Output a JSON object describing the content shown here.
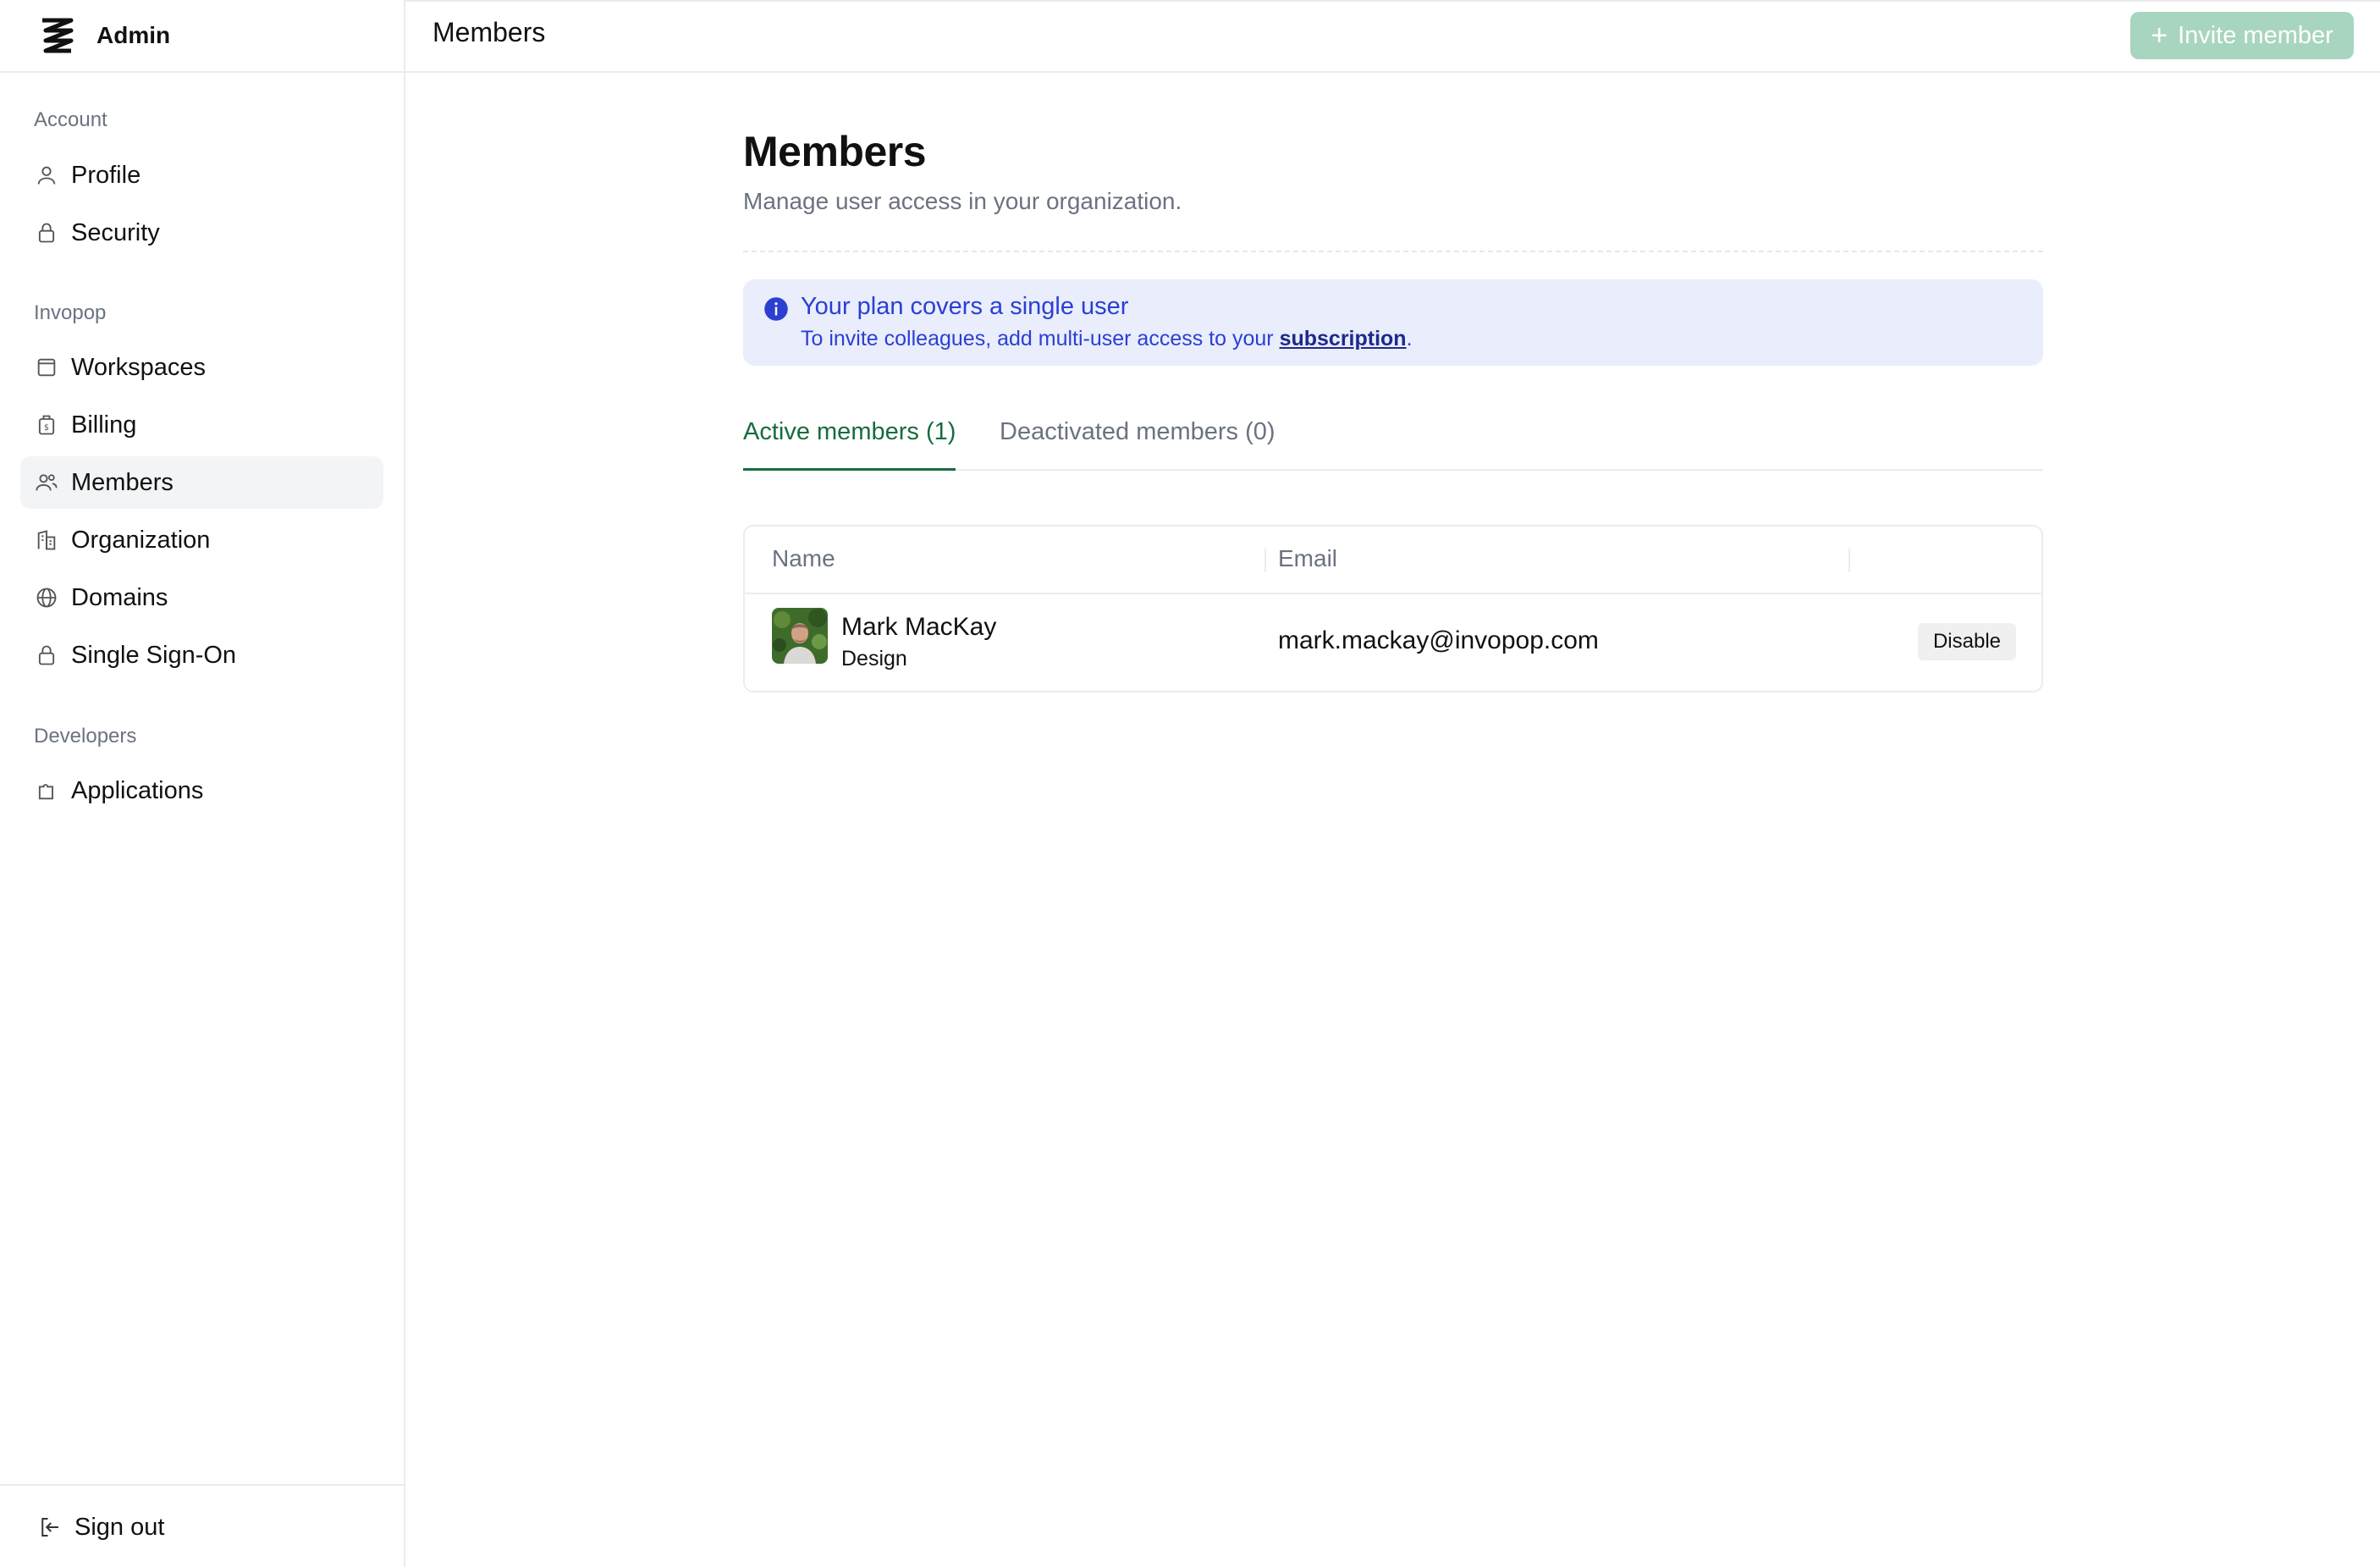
{
  "brand": {
    "name": "Admin"
  },
  "header": {
    "title": "Members",
    "invite_label": "Invite member"
  },
  "sidebar": {
    "sections": [
      {
        "label": "Account",
        "items": [
          {
            "label": "Profile",
            "icon": "user-icon"
          },
          {
            "label": "Security",
            "icon": "lock-icon"
          }
        ]
      },
      {
        "label": "Invopop",
        "items": [
          {
            "label": "Workspaces",
            "icon": "window-icon"
          },
          {
            "label": "Billing",
            "icon": "billing-icon"
          },
          {
            "label": "Members",
            "icon": "users-icon",
            "active": true
          },
          {
            "label": "Organization",
            "icon": "building-icon"
          },
          {
            "label": "Domains",
            "icon": "globe-icon"
          },
          {
            "label": "Single Sign-On",
            "icon": "lock-icon"
          }
        ]
      },
      {
        "label": "Developers",
        "items": [
          {
            "label": "Applications",
            "icon": "puzzle-icon"
          }
        ]
      }
    ],
    "signout_label": "Sign out"
  },
  "main": {
    "title": "Members",
    "subtitle": "Manage user access in your organization.",
    "alert": {
      "title": "Your plan covers a single user",
      "body_prefix": "To invite colleagues, add multi-user access to your ",
      "link": "subscription",
      "body_suffix": "."
    },
    "tabs": [
      {
        "label": "Active members (1)",
        "active": true
      },
      {
        "label": "Deactivated members (0)",
        "active": false
      }
    ],
    "table": {
      "columns": [
        "Name",
        "Email"
      ],
      "rows": [
        {
          "name": "Mark MacKay",
          "department": "Design",
          "email": "mark.mackay@invopop.com",
          "action": "Disable"
        }
      ]
    }
  },
  "colors": {
    "accent": "#166c3f",
    "invite_button": "#a8d5c0",
    "alert_bg": "#e9edfc",
    "alert_text": "#2b3fd1"
  }
}
